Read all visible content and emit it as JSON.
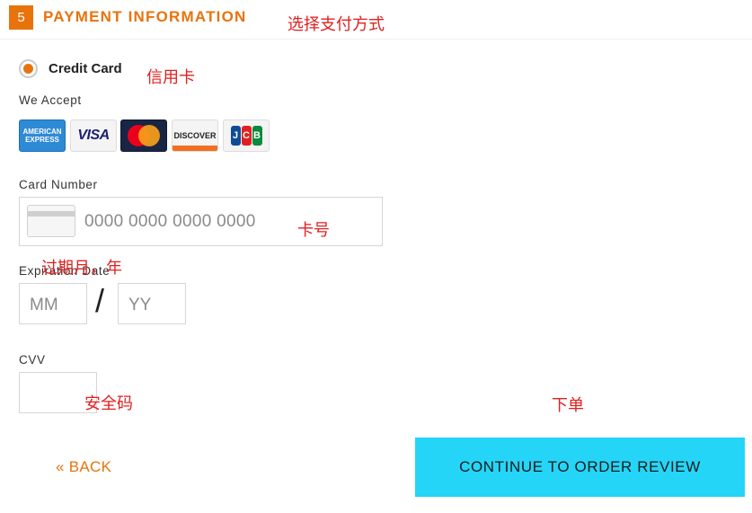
{
  "section": {
    "step_number": "5",
    "title": "PAYMENT INFORMATION"
  },
  "payment_method": {
    "selected": true,
    "label": "Credit Card"
  },
  "accepted_cards": {
    "label": "We Accept",
    "cards": [
      {
        "name": "American Express",
        "logo_text": [
          "AMERICAN",
          "EXPRESS"
        ]
      },
      {
        "name": "Visa",
        "logo_text": "VISA"
      },
      {
        "name": "Mastercard",
        "logo_text": ""
      },
      {
        "name": "Discover",
        "logo_text": "DISCOVER"
      },
      {
        "name": "JCB",
        "logo_text": [
          "J",
          "C",
          "B"
        ]
      }
    ]
  },
  "card_number": {
    "label": "Card Number",
    "placeholder": "0000 0000 0000 0000",
    "value": ""
  },
  "expiration": {
    "label": "Expiration Date",
    "month_placeholder": "MM",
    "year_placeholder": "YY",
    "separator": "/"
  },
  "cvv": {
    "label": "CVV",
    "value": ""
  },
  "actions": {
    "back_label": "« BACK",
    "continue_label": "CONTINUE TO ORDER REVIEW"
  },
  "annotations": {
    "payment_method": "选择支付方式",
    "credit_card": "信用卡",
    "card_number": "卡号",
    "expiration": "过期月，年",
    "cvv": "安全码",
    "place_order": "下单"
  },
  "colors": {
    "accent": "#e8730c",
    "button": "#25d5f7",
    "annotation": "#e02020"
  }
}
